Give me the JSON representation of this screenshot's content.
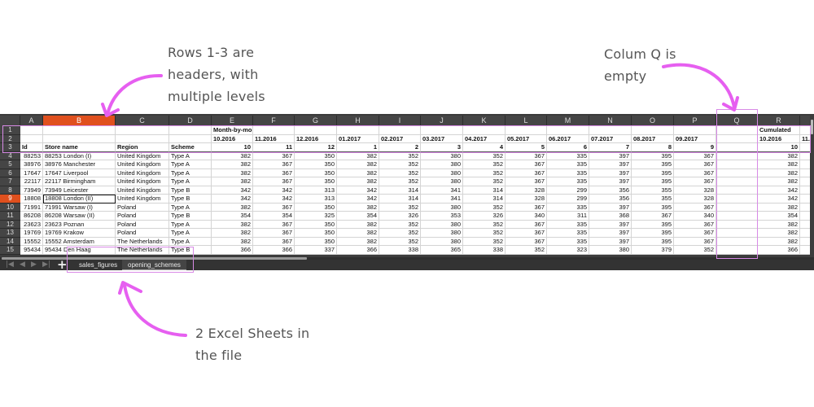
{
  "annotations": {
    "headers_note": [
      "Rows 1-3 are",
      "headers, with",
      "multiple levels"
    ],
    "colq_note": [
      "Colum Q is",
      "empty"
    ],
    "sheets_note": [
      "2 Excel Sheets in",
      "the file"
    ],
    "accent_color": "#e65ff0"
  },
  "spreadsheet": {
    "selected_color": "#e0501e",
    "columns": [
      "A",
      "B",
      "C",
      "D",
      "E",
      "F",
      "G",
      "H",
      "I",
      "J",
      "K",
      "L",
      "M",
      "N",
      "O",
      "P",
      "Q",
      "R",
      ""
    ],
    "selected_column": "B",
    "selected_row": 9,
    "active_cell": "B9",
    "header_rows": {
      "row1": {
        "E": "Month-by-month",
        "R": "Cumulated"
      },
      "row2": {
        "E": "10.2016",
        "F": "11.2016",
        "G": "12.2016",
        "H": "01.2017",
        "I": "02.2017",
        "J": "03.2017",
        "K": "04.2017",
        "L": "05.2017",
        "M": "06.2017",
        "N": "07.2017",
        "O": "08.2017",
        "P": "09.2017",
        "R": "10.2016",
        "S": "11."
      },
      "row3": {
        "A": "Id",
        "B": "Store name",
        "C": "Region",
        "D": "Scheme",
        "E": "10",
        "F": "11",
        "G": "12",
        "H": "1",
        "I": "2",
        "J": "3",
        "K": "4",
        "L": "5",
        "M": "6",
        "N": "7",
        "O": "8",
        "P": "9",
        "R": "10"
      }
    },
    "rows": [
      {
        "n": 4,
        "id": "88253",
        "store": "88253 London (I)",
        "region": "United Kingdom",
        "scheme": "Type A",
        "vals": [
          "382",
          "367",
          "350",
          "382",
          "352",
          "380",
          "352",
          "367",
          "335",
          "397",
          "395",
          "367"
        ],
        "cum": "382"
      },
      {
        "n": 5,
        "id": "38976",
        "store": "38976 Manchester",
        "region": "United Kingdom",
        "scheme": "Type A",
        "vals": [
          "382",
          "367",
          "350",
          "382",
          "352",
          "380",
          "352",
          "367",
          "335",
          "397",
          "395",
          "367"
        ],
        "cum": "382"
      },
      {
        "n": 6,
        "id": "17647",
        "store": "17647 Liverpool",
        "region": "United Kingdom",
        "scheme": "Type A",
        "vals": [
          "382",
          "367",
          "350",
          "382",
          "352",
          "380",
          "352",
          "367",
          "335",
          "397",
          "395",
          "367"
        ],
        "cum": "382"
      },
      {
        "n": 7,
        "id": "22117",
        "store": "22117 Birmingham",
        "region": "United Kingdom",
        "scheme": "Type A",
        "vals": [
          "382",
          "367",
          "350",
          "382",
          "352",
          "380",
          "352",
          "367",
          "335",
          "397",
          "395",
          "367"
        ],
        "cum": "382"
      },
      {
        "n": 8,
        "id": "73949",
        "store": "73949 Leicester",
        "region": "United Kingdom",
        "scheme": "Type B",
        "vals": [
          "342",
          "342",
          "313",
          "342",
          "314",
          "341",
          "314",
          "328",
          "299",
          "356",
          "355",
          "328"
        ],
        "cum": "342"
      },
      {
        "n": 9,
        "id": "18808",
        "store": "18808 London (II)",
        "region": "United Kingdom",
        "scheme": "Type B",
        "vals": [
          "342",
          "342",
          "313",
          "342",
          "314",
          "341",
          "314",
          "328",
          "299",
          "356",
          "355",
          "328"
        ],
        "cum": "342"
      },
      {
        "n": 10,
        "id": "71991",
        "store": "71991 Warsaw (I)",
        "region": "Poland",
        "scheme": "Type A",
        "vals": [
          "382",
          "367",
          "350",
          "382",
          "352",
          "380",
          "352",
          "367",
          "335",
          "397",
          "395",
          "367"
        ],
        "cum": "382"
      },
      {
        "n": 11,
        "id": "86208",
        "store": "86208 Warsaw (II)",
        "region": "Poland",
        "scheme": "Type B",
        "vals": [
          "354",
          "354",
          "325",
          "354",
          "326",
          "353",
          "326",
          "340",
          "311",
          "368",
          "367",
          "340"
        ],
        "cum": "354"
      },
      {
        "n": 12,
        "id": "23623",
        "store": "23623 Poznan",
        "region": "Poland",
        "scheme": "Type A",
        "vals": [
          "382",
          "367",
          "350",
          "382",
          "352",
          "380",
          "352",
          "367",
          "335",
          "397",
          "395",
          "367"
        ],
        "cum": "382"
      },
      {
        "n": 13,
        "id": "19769",
        "store": "19769 Krakow",
        "region": "Poland",
        "scheme": "Type A",
        "vals": [
          "382",
          "367",
          "350",
          "382",
          "352",
          "380",
          "352",
          "367",
          "335",
          "397",
          "395",
          "367"
        ],
        "cum": "382"
      },
      {
        "n": 14,
        "id": "15552",
        "store": "15552 Amsterdam",
        "region": "The Netherlands",
        "scheme": "Type A",
        "vals": [
          "382",
          "367",
          "350",
          "382",
          "352",
          "380",
          "352",
          "367",
          "335",
          "397",
          "395",
          "367"
        ],
        "cum": "382"
      },
      {
        "n": 15,
        "id": "95434",
        "store": "95434 Den Haag",
        "region": "The Netherlands",
        "scheme": "Type B",
        "vals": [
          "366",
          "366",
          "337",
          "366",
          "338",
          "365",
          "338",
          "352",
          "323",
          "380",
          "379",
          "352"
        ],
        "cum": "366"
      }
    ],
    "sheet_tabs": [
      {
        "label": "sales_figures",
        "active": false
      },
      {
        "label": "opening_schemes",
        "active": true
      }
    ],
    "add_sheet_icon": "plus-icon",
    "nav_icons": [
      "first-sheet-icon",
      "prev-sheet-icon",
      "next-sheet-icon",
      "last-sheet-icon"
    ]
  }
}
